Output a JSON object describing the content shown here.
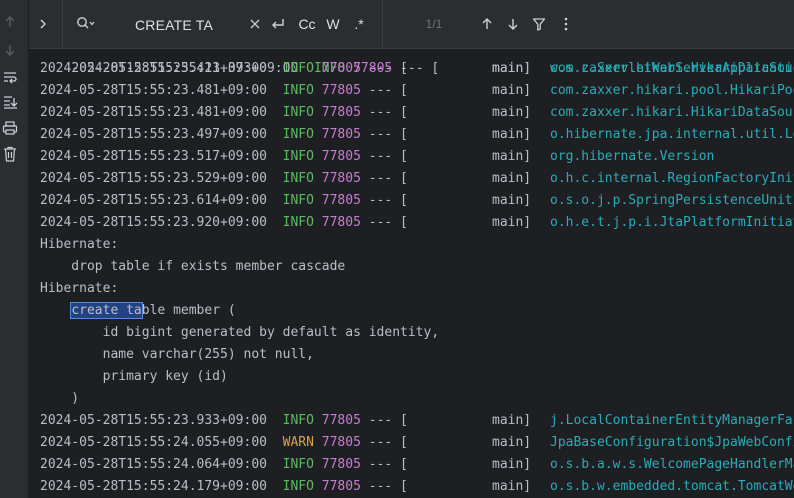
{
  "search": {
    "query": "CREATE TA",
    "match_counter": "1/1",
    "case_label": "Cc",
    "word_label": "W",
    "regex_label": ".*"
  },
  "console": {
    "top_partial": {
      "timestamp": "2024-05-28T15:55:23.373+09:00",
      "level": "INFO",
      "pid": "77805",
      "sep": "--- [",
      "thread": "main]",
      "logger": "w.s.c.ServletWebServerApplication"
    },
    "logs_a": [
      {
        "timestamp": "2024-05-28T15:55:23.411+09:00",
        "level": "INFO",
        "pid": "77805",
        "sep": "--- [",
        "thread": "main]",
        "logger": "com.zaxxer.hikari.HikariDataSource"
      },
      {
        "timestamp": "2024-05-28T15:55:23.481+09:00",
        "level": "INFO",
        "pid": "77805",
        "sep": "--- [",
        "thread": "main]",
        "logger": "com.zaxxer.hikari.pool.HikariPool"
      },
      {
        "timestamp": "2024-05-28T15:55:23.481+09:00",
        "level": "INFO",
        "pid": "77805",
        "sep": "--- [",
        "thread": "main]",
        "logger": "com.zaxxer.hikari.HikariDataSource"
      },
      {
        "timestamp": "2024-05-28T15:55:23.497+09:00",
        "level": "INFO",
        "pid": "77805",
        "sep": "--- [",
        "thread": "main]",
        "logger": "o.hibernate.jpa.internal.util.LogHelper"
      },
      {
        "timestamp": "2024-05-28T15:55:23.517+09:00",
        "level": "INFO",
        "pid": "77805",
        "sep": "--- [",
        "thread": "main]",
        "logger": "org.hibernate.Version"
      },
      {
        "timestamp": "2024-05-28T15:55:23.529+09:00",
        "level": "INFO",
        "pid": "77805",
        "sep": "--- [",
        "thread": "main]",
        "logger": "o.h.c.internal.RegionFactoryInitiator"
      },
      {
        "timestamp": "2024-05-28T15:55:23.614+09:00",
        "level": "INFO",
        "pid": "77805",
        "sep": "--- [",
        "thread": "main]",
        "logger": "o.s.o.j.p.SpringPersistenceUnitInfo"
      },
      {
        "timestamp": "2024-05-28T15:55:23.920+09:00",
        "level": "INFO",
        "pid": "77805",
        "sep": "--- [",
        "thread": "main]",
        "logger": "o.h.e.t.j.p.i.JtaPlatformInitiator"
      }
    ],
    "hibernate_label_1": "Hibernate:",
    "drop_sql": "    drop table if exists member cascade",
    "hibernate_label_2": "Hibernate:",
    "create_match": "create ta",
    "create_rest": "ble member (",
    "sql_lines": [
      "        id bigint generated by default as identity,",
      "        name varchar(255) not null,",
      "        primary key (id)",
      "    )"
    ],
    "logs_b": [
      {
        "timestamp": "2024-05-28T15:55:23.933+09:00",
        "level": "INFO",
        "pid": "77805",
        "sep": "--- [",
        "thread": "main]",
        "logger": "j.LocalContainerEntityManagerFactoryBean"
      },
      {
        "timestamp": "2024-05-28T15:55:24.055+09:00",
        "level": "WARN",
        "pid": "77805",
        "sep": "--- [",
        "thread": "main]",
        "logger": "JpaBaseConfiguration$JpaWebConfiguration"
      },
      {
        "timestamp": "2024-05-28T15:55:24.064+09:00",
        "level": "INFO",
        "pid": "77805",
        "sep": "--- [",
        "thread": "main]",
        "logger": "o.s.b.a.w.s.WelcomePageHandlerMapping"
      },
      {
        "timestamp": "2024-05-28T15:55:24.179+09:00",
        "level": "INFO",
        "pid": "77805",
        "sep": "--- [",
        "thread": "main]",
        "logger": "o.s.b.w.embedded.tomcat.TomcatWebServer"
      }
    ]
  },
  "icons": {
    "gutter": [
      "arrow-up-icon",
      "arrow-down-icon",
      "soft-wrap-icon",
      "scroll-to-end-icon",
      "print-icon",
      "trash-icon"
    ],
    "search": [
      "expand-chevron-icon",
      "search-history-icon",
      "clear-icon",
      "replace-toggle-icon",
      "prev-occurrence-icon",
      "next-occurrence-icon",
      "filter-icon",
      "more-options-icon"
    ]
  },
  "colors": {
    "background": "#1e1f22",
    "toolbar": "#2b2d30",
    "info": "#5fb865",
    "warn": "#d6a34a",
    "pid": "#c77dd1",
    "logger": "#2aacb8",
    "match_highlight": "#214283"
  }
}
